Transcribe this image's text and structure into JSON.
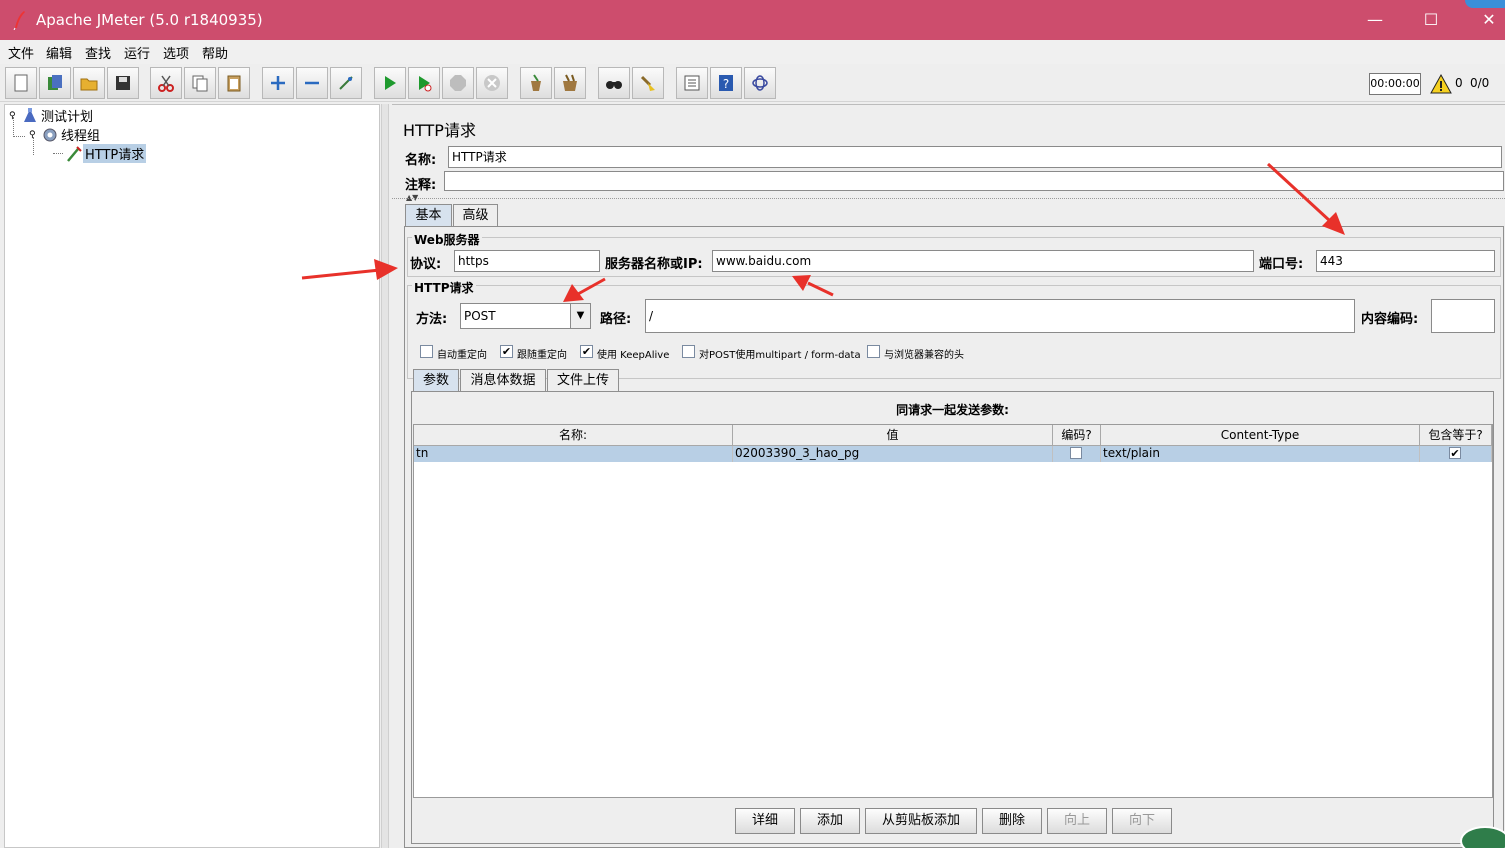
{
  "window": {
    "title": "Apache JMeter (5.0 r1840935)"
  },
  "menu": [
    "文件",
    "编辑",
    "查找",
    "运行",
    "选项",
    "帮助"
  ],
  "toolbar": {
    "timer": "00:00:00",
    "warnings": "0",
    "threads": "0/0",
    "icons": [
      "new-icon",
      "templates-icon",
      "open-icon",
      "save-icon",
      "cut-icon",
      "copy-icon",
      "paste-icon",
      "expand-icon",
      "collapse-icon",
      "toggle-icon",
      "start-icon",
      "start-no-pause-icon",
      "stop-icon",
      "shutdown-icon",
      "clear-icon",
      "clear-all-icon",
      "search-icon",
      "reset-search-icon",
      "function-helper-icon",
      "help-icon",
      "remote-icon"
    ]
  },
  "tree": {
    "items": [
      "测试计划",
      "线程组",
      "HTTP请求"
    ]
  },
  "panel": {
    "title": "HTTP请求",
    "name_label": "名称:",
    "name_value": "HTTP请求",
    "comment_label": "注释:",
    "comment_value": "",
    "tabs": [
      "基本",
      "高级"
    ],
    "web_server": {
      "title": "Web服务器",
      "protocol_label": "协议:",
      "protocol": "https",
      "server_label": "服务器名称或IP:",
      "server": "www.baidu.com",
      "port_label": "端口号:",
      "port": "443"
    },
    "http_request": {
      "title": "HTTP请求",
      "method_label": "方法:",
      "method": "POST",
      "path_label": "路径:",
      "path": "/",
      "encoding_label": "内容编码:",
      "encoding": ""
    },
    "options": [
      {
        "label": "自动重定向",
        "checked": false
      },
      {
        "label": "跟随重定向",
        "checked": true
      },
      {
        "label": "使用 KeepAlive",
        "checked": true
      },
      {
        "label": "对POST使用multipart / form-data",
        "checked": false
      },
      {
        "label": "与浏览器兼容的头",
        "checked": false
      }
    ],
    "sub_tabs": [
      "参数",
      "消息体数据",
      "文件上传"
    ],
    "params": {
      "caption": "同请求一起发送参数:",
      "columns": [
        "名称:",
        "值",
        "编码?",
        "Content-Type",
        "包含等于?"
      ],
      "rows": [
        {
          "name": "tn",
          "value": "02003390_3_hao_pg",
          "encode": false,
          "content_type": "text/plain",
          "include_equals": true
        }
      ]
    },
    "buttons": [
      {
        "label": "详细",
        "enabled": true
      },
      {
        "label": "添加",
        "enabled": true
      },
      {
        "label": "从剪贴板添加",
        "enabled": true
      },
      {
        "label": "删除",
        "enabled": true
      },
      {
        "label": "向上",
        "enabled": false
      },
      {
        "label": "向下",
        "enabled": false
      }
    ]
  },
  "colors": {
    "titlebar": "#cd4d6d",
    "selection": "#b8cfe5",
    "annotation_arrow": "#e8312a"
  }
}
